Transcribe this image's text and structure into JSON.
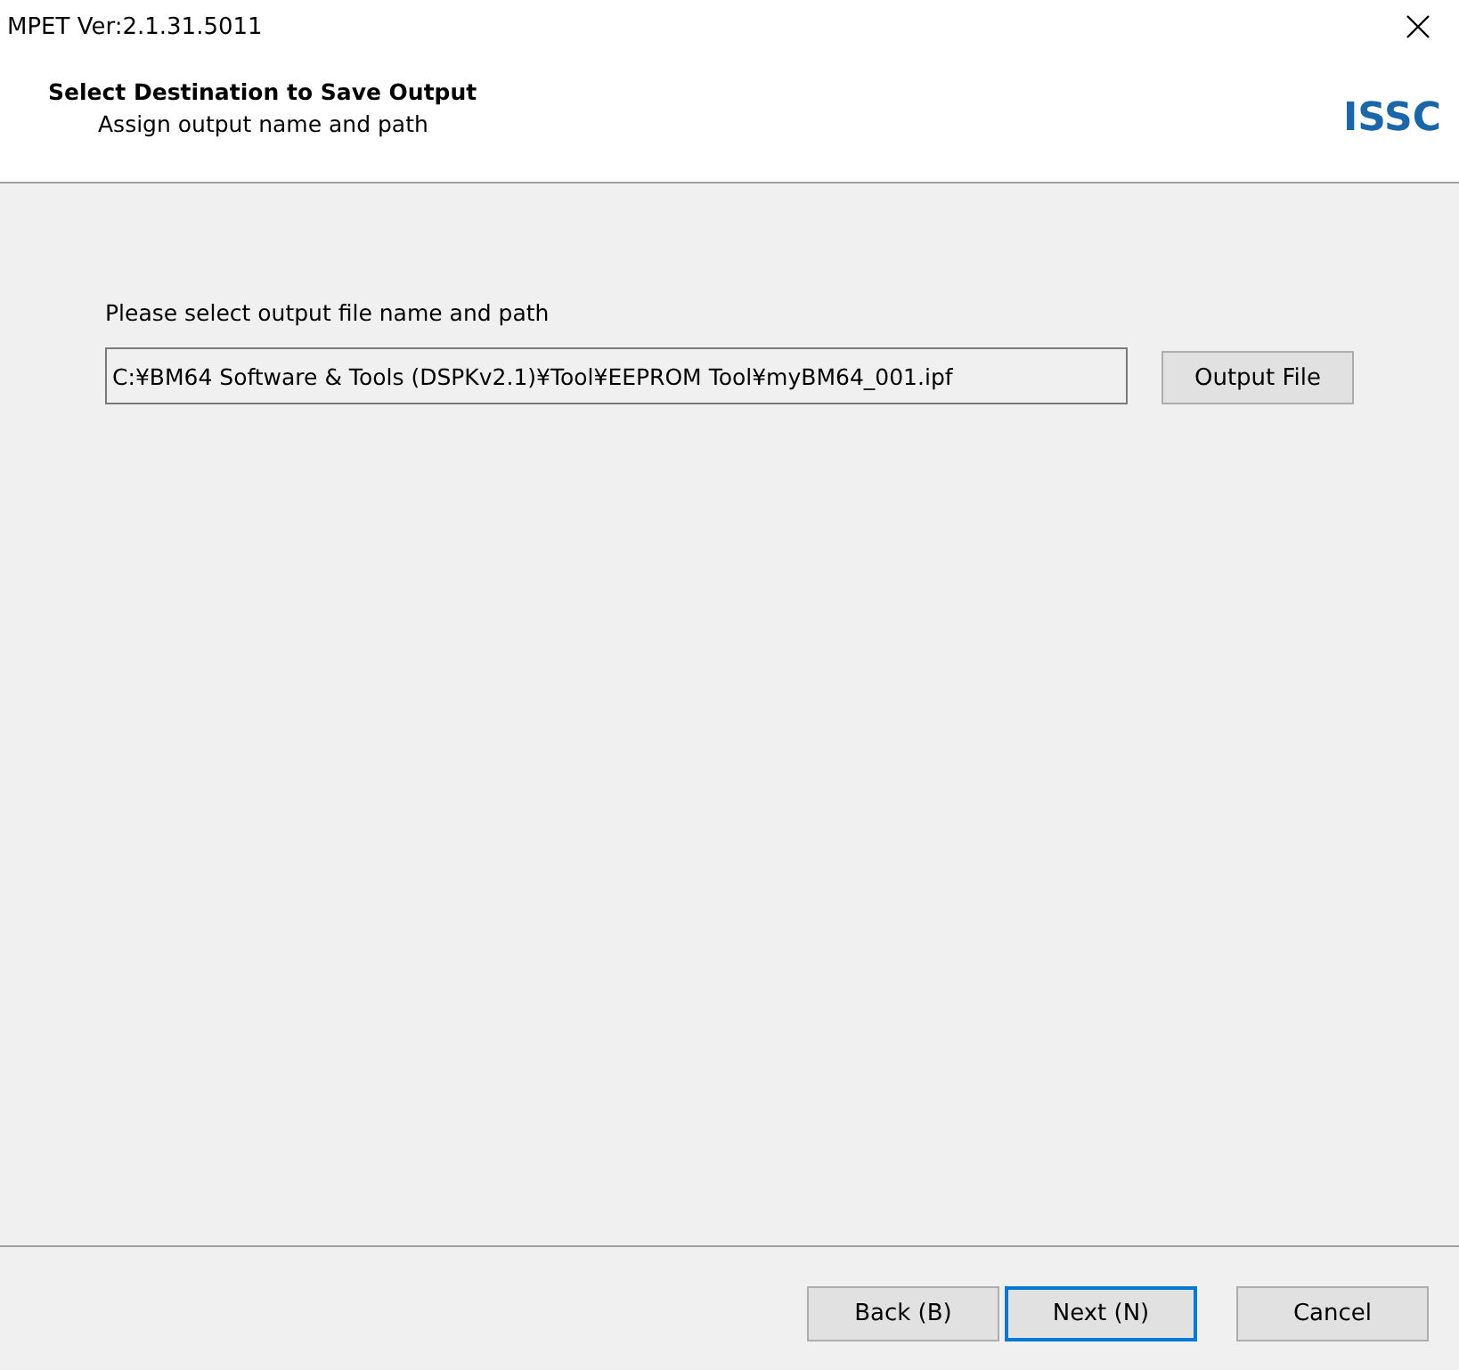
{
  "window": {
    "title": "MPET Ver:2.1.31.5011"
  },
  "header": {
    "title": "Select Destination to Save Output",
    "subtitle": "Assign output name and path",
    "logo": "ISSC"
  },
  "form": {
    "label": "Please select output file name and path",
    "path": {
      "value": "C:¥BM64 Software & Tools (DSPKv2.1)¥Tool¥EEPROM Tool¥myBM64_001.ipf"
    },
    "browse_button": "Output File"
  },
  "buttons": [
    {
      "label": "Back (B)",
      "default": false
    },
    {
      "label": "Next (N)",
      "default": true
    },
    {
      "label": "Cancel",
      "default": false
    }
  ]
}
